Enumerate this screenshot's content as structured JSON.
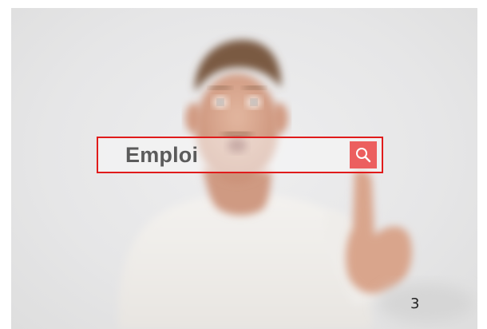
{
  "search": {
    "value": "Emploi"
  },
  "icons": {
    "search_button": "search-icon"
  },
  "colors": {
    "search_border": "#e01b1b",
    "search_button": "#ec5f5f"
  },
  "page_number": "3"
}
